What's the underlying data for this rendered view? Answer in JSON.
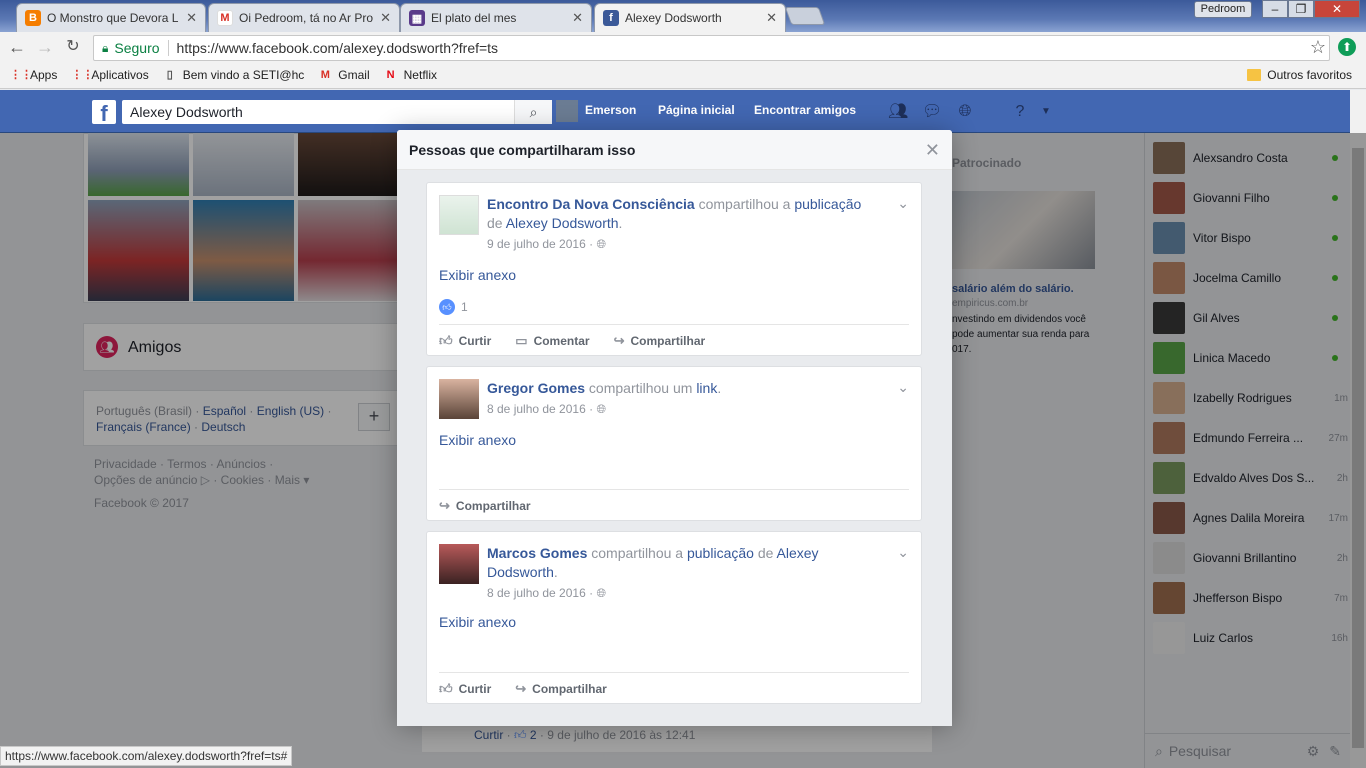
{
  "browser": {
    "tabs": [
      {
        "title": "O Monstro que Devora L",
        "favicon": "blogger-icon",
        "color": "#f57d00"
      },
      {
        "title": "Oi Pedroom, tá no Ar Pro",
        "favicon": "gmail-icon",
        "color": "#d93025"
      },
      {
        "title": "El plato del mes",
        "favicon": "site-icon",
        "color": "#5a3a8a"
      },
      {
        "title": "Alexey Dodsworth",
        "favicon": "facebook-icon",
        "color": "#3b5998"
      }
    ],
    "profile_name": "Pedroom",
    "window_controls": [
      "–",
      "❐",
      "✕"
    ],
    "secure_label": "Seguro",
    "url": "https://www.facebook.com/alexey.dodsworth?fref=ts",
    "bookmarks": [
      {
        "label": "Apps",
        "icon": "apps-grid-icon"
      },
      {
        "label": "Aplicativos",
        "icon": "apps-grid-icon"
      },
      {
        "label": "Bem vindo a SETI@hc",
        "icon": "page-icon"
      },
      {
        "label": "Gmail",
        "icon": "gmail-icon"
      },
      {
        "label": "Netflix",
        "icon": "netflix-icon"
      }
    ],
    "other_bookmarks": "Outros favoritos",
    "status_url": "https://www.facebook.com/alexey.dodsworth?fref=ts#"
  },
  "facebook": {
    "search_value": "Alexey Dodsworth",
    "nav": {
      "user": "Emerson",
      "home": "Página inicial",
      "find_friends": "Encontrar amigos"
    },
    "brand_color": "#4267b2",
    "friends_label": "Amigos",
    "languages": {
      "current": "Português (Brasil)",
      "others": [
        "Español",
        "English (US)",
        "Français (France)",
        "Deutsch"
      ]
    },
    "footer_links": [
      "Privacidade",
      "Termos",
      "Anúncios",
      "Opções de anúncio",
      "Cookies",
      "Mais"
    ],
    "copyright": "Facebook © 2017",
    "sponsored": {
      "title": "Patrocinado",
      "ad_title": "salário além do salário.",
      "ad_domain": "empiricus.com.br",
      "ad_text": "nvestindo em dividendos você pode aumentar sua renda para 017."
    },
    "comment_strip": {
      "action": "Curtir",
      "likes": "2",
      "date": "9 de julho de 2016 às 12:41"
    },
    "chat": {
      "contacts": [
        {
          "name": "Alexsandro Costa",
          "status": "online"
        },
        {
          "name": "Giovanni Filho",
          "status": "online"
        },
        {
          "name": "Vitor Bispo",
          "status": "online"
        },
        {
          "name": "Jocelma Camillo",
          "status": "online"
        },
        {
          "name": "Gil Alves",
          "status": "online"
        },
        {
          "name": "Linica Macedo",
          "status": "online"
        },
        {
          "name": "Izabelly Rodrigues",
          "status": "1m"
        },
        {
          "name": "Edmundo Ferreira ...",
          "status": "27m"
        },
        {
          "name": "Edvaldo Alves Dos S...",
          "status": "2h"
        },
        {
          "name": "Agnes Dalila Moreira",
          "status": "17m"
        },
        {
          "name": "Giovanni Brillantino",
          "status": "2h"
        },
        {
          "name": "Jhefferson Bispo",
          "status": "7m"
        },
        {
          "name": "Luiz Carlos",
          "status": "16h"
        }
      ],
      "search_placeholder": "Pesquisar"
    }
  },
  "modal": {
    "title": "Pessoas que compartilharam isso",
    "shares": [
      {
        "who": "Encontro Da Nova Consciência",
        "verb": "compartilhou a",
        "object": "publicação",
        "prep": "de",
        "owner": "Alexey Dodsworth",
        "date": "9 de julho de 2016",
        "attachment": "Exibir anexo",
        "likes": "1",
        "actions": [
          "Curtir",
          "Comentar",
          "Compartilhar"
        ]
      },
      {
        "who": "Gregor Gomes",
        "verb": "compartilhou um",
        "object": "link",
        "date": "8 de julho de 2016",
        "attachment": "Exibir anexo",
        "actions": [
          "Compartilhar"
        ]
      },
      {
        "who": "Marcos Gomes",
        "verb": "compartilhou a",
        "object": "publicação",
        "prep": "de",
        "owner": "Alexey Dodsworth",
        "date": "8 de julho de 2016",
        "attachment": "Exibir anexo",
        "actions": [
          "Curtir",
          "Compartilhar"
        ]
      }
    ]
  }
}
